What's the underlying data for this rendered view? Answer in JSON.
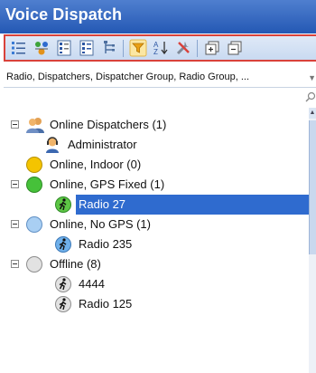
{
  "window": {
    "title": "Voice Dispatch"
  },
  "toolbar": {
    "buttons": [
      "list-view-icon",
      "dispatchers-icon",
      "grid-view-icon",
      "grid-view-alt-icon",
      "tree-structure-icon",
      "filter-icon",
      "sort-icon",
      "tools-icon",
      "expand-all-icon",
      "collapse-all-icon"
    ]
  },
  "filter": {
    "text": "Radio, Dispatchers, Dispatcher Group, Radio Group, ..."
  },
  "tree": {
    "online_dispatchers": "Online Dispatchers (1)",
    "administrator": "Administrator",
    "online_indoor": "Online, Indoor (0)",
    "online_gps_fixed": "Online, GPS Fixed (1)",
    "radio_27": "Radio 27",
    "online_no_gps": "Online, No GPS (1)",
    "radio_235": "Radio 235",
    "offline": "Offline (8)",
    "radio_4444": "4444",
    "radio_125": "Radio 125"
  },
  "colors": {
    "title_bar": "#2e63bd",
    "selection": "#2f6bcf",
    "online_indoor": "#f4c400",
    "online_gps_fixed": "#46c13a",
    "online_no_gps": "#8fc0ee",
    "offline": "#d8d8d8",
    "toolbar_highlight": "#d9423b"
  }
}
